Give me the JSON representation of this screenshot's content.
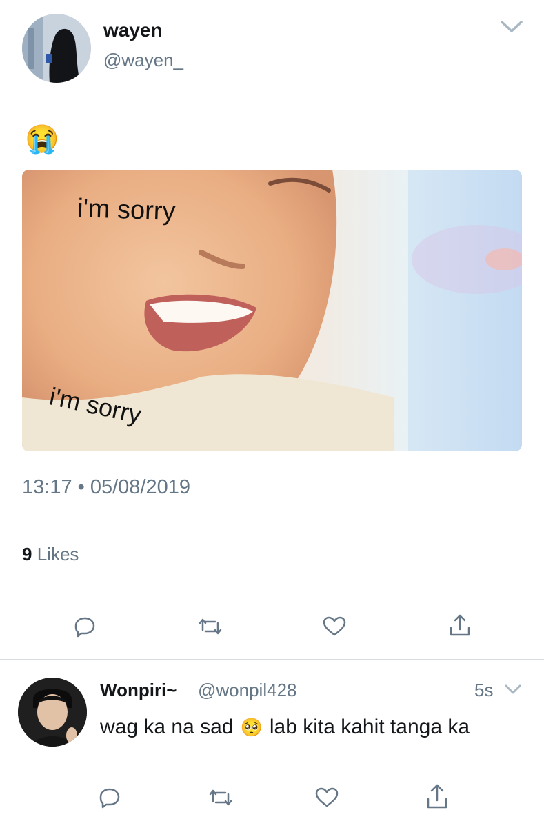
{
  "tweet": {
    "display_name": "wayen",
    "handle": "@wayen_",
    "text_emoji": "😭",
    "media": {
      "caption_top": "i'm sorry",
      "caption_bottom": "i'm sorry"
    },
    "timestamp": "13:17 • 05/08/2019",
    "likes_count": "9",
    "likes_label": "Likes",
    "actions": [
      "reply-icon",
      "retweet-icon",
      "like-icon",
      "share-icon"
    ]
  },
  "reply": {
    "display_name": "Wonpiri~",
    "handle": "@wonpil428",
    "time": "5s",
    "text_before": "wag ka na sad",
    "emoji": "🥺",
    "text_after": "lab kita kahit tanga ka",
    "actions": [
      "reply-icon",
      "retweet-icon",
      "like-icon",
      "share-icon"
    ]
  },
  "colors": {
    "text": "#14171a",
    "muted": "#657786",
    "divider": "#d6dce1",
    "icon": "#657786"
  }
}
